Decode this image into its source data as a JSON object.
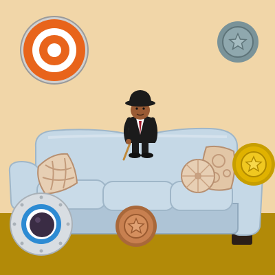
{
  "scene": {
    "wall_color": "#f1d6a8",
    "floor_color": "#b28a08",
    "sofa_color": "#c5d8e6",
    "sofa_shadow_color": "#9fb6c8",
    "pillow_color": "#e7cfb4"
  },
  "character": {
    "name": "gentleman-with-bowler-hat-and-cane",
    "suit_color": "#1b1b1b",
    "skin_color": "#9a5b34",
    "tie_color": "#a11a2a"
  },
  "controls": [
    {
      "name": "target-button",
      "icon": "target-icon",
      "color": "#e8641b"
    },
    {
      "name": "gray-star-coin-button",
      "icon": "star-icon",
      "color": "#7a9399"
    },
    {
      "name": "gold-star-coin-button",
      "icon": "star-icon",
      "color": "#e0b200"
    },
    {
      "name": "bronze-star-coin-button",
      "icon": "star-icon",
      "color": "#c88050"
    },
    {
      "name": "joystick-button",
      "icon": "joystick-icon",
      "color": "#2d8bd3"
    }
  ]
}
